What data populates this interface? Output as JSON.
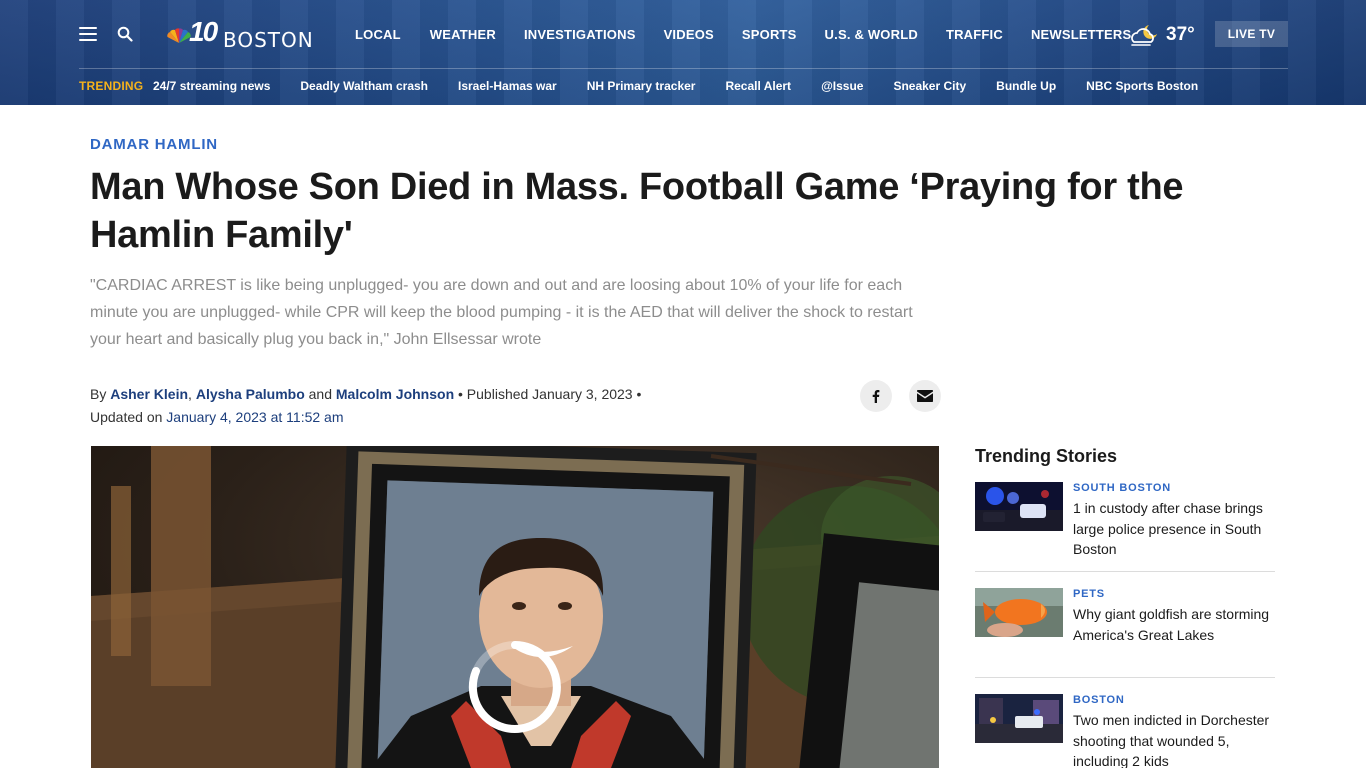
{
  "header": {
    "logo_number": "10",
    "logo_city": "BOSTON",
    "nav": [
      "LOCAL",
      "WEATHER",
      "INVESTIGATIONS",
      "VIDEOS",
      "SPORTS",
      "U.S. & WORLD",
      "TRAFFIC",
      "NEWSLETTERS"
    ],
    "weather": {
      "temperature": "37°",
      "icon": "partly-cloudy-night-icon"
    },
    "live_tv_label": "LIVE TV",
    "trending_label": "TRENDING",
    "trending_links": [
      "24/7 streaming news",
      "Deadly Waltham crash",
      "Israel-Hamas war",
      "NH Primary tracker",
      "Recall Alert",
      "@Issue",
      "Sneaker City",
      "Bundle Up",
      "NBC Sports Boston"
    ]
  },
  "article": {
    "section": "DAMAR HAMLIN",
    "headline": "Man Whose Son Died in Mass. Football Game ‘Praying for the Hamlin Family'",
    "dek": "\"CARDIAC ARREST is like being unplugged- you are down and out and are loosing about 10% of your life for each minute you are unplugged- while CPR will keep the blood pumping - it is the AED that will deliver the shock to restart your heart and basically plug you back in,\" John Ellsessar wrote",
    "byline": {
      "by": "By",
      "authors": [
        "Asher Klein",
        "Alysha Palumbo",
        "Malcolm Johnson"
      ],
      "sep_comma": ",",
      "and": "and",
      "published": "• Published January 3, 2023 •",
      "updated_prefix": "Updated on",
      "updated": "January 4, 2023 at 11:52 am"
    },
    "share_icons": [
      "facebook-icon",
      "email-icon"
    ]
  },
  "sidebar": {
    "title": "Trending Stories",
    "stories": [
      {
        "category": "SOUTH BOSTON",
        "title": "1 in custody after chase brings large police presence in South Boston"
      },
      {
        "category": "PETS",
        "title": "Why giant goldfish are storming America's Great Lakes"
      },
      {
        "category": "BOSTON",
        "title": "Two men indicted in Dorchester shooting that wounded 5, including 2 kids"
      }
    ]
  },
  "colors": {
    "header_blue": "#24508f",
    "trending_gold": "#f5b21b",
    "accent_blue": "#2f67c4",
    "link_navy": "#1d3f7d"
  }
}
